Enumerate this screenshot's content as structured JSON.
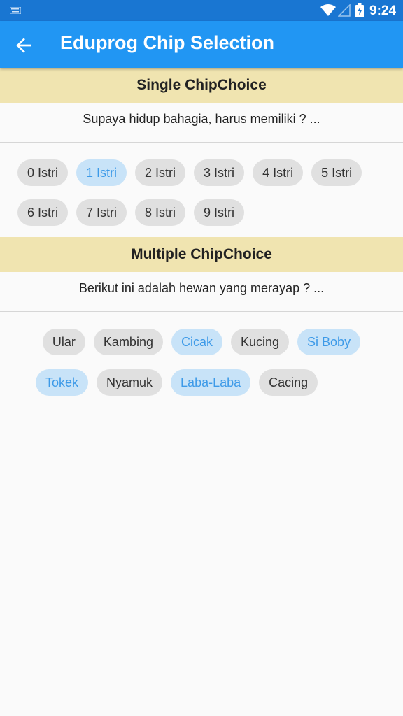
{
  "status_bar": {
    "time": "9:24",
    "icons": [
      "keyboard-icon",
      "wifi-icon",
      "signal-icon",
      "battery-icon"
    ]
  },
  "app_bar": {
    "title": "Eduprog Chip Selection",
    "back_icon": "arrow-back-icon"
  },
  "single": {
    "header": "Single ChipChoice",
    "question": "Supaya hidup bahagia, harus memiliki ? ...",
    "chips": [
      {
        "label": "0 Istri",
        "selected": false
      },
      {
        "label": "1 Istri",
        "selected": true
      },
      {
        "label": "2 Istri",
        "selected": false
      },
      {
        "label": "3 Istri",
        "selected": false
      },
      {
        "label": "4 Istri",
        "selected": false
      },
      {
        "label": "5 Istri",
        "selected": false
      },
      {
        "label": "6 Istri",
        "selected": false
      },
      {
        "label": "7 Istri",
        "selected": false
      },
      {
        "label": "8 Istri",
        "selected": false
      },
      {
        "label": "9 Istri",
        "selected": false
      }
    ]
  },
  "multiple": {
    "header": "Multiple ChipChoice",
    "question": "Berikut ini adalah hewan yang merayap ? ...",
    "chips": [
      {
        "label": "Ular",
        "selected": false
      },
      {
        "label": "Kambing",
        "selected": false
      },
      {
        "label": "Cicak",
        "selected": true
      },
      {
        "label": "Kucing",
        "selected": false
      },
      {
        "label": "Si Boby",
        "selected": true
      },
      {
        "label": "Tokek",
        "selected": true
      },
      {
        "label": "Nyamuk",
        "selected": false
      },
      {
        "label": "Laba-Laba",
        "selected": true
      },
      {
        "label": "Cacing",
        "selected": false
      }
    ]
  },
  "colors": {
    "status_bar": "#1976d2",
    "app_bar": "#2196f3",
    "section_header": "#f0e4b0",
    "chip": "#e0e0e0",
    "chip_selected": "#c8e3f8",
    "chip_selected_text": "#3d9ae8"
  }
}
